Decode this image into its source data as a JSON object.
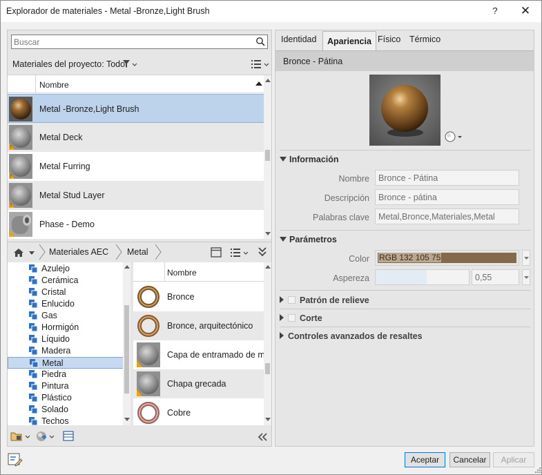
{
  "window": {
    "title": "Explorador de materiales - Metal -Bronze,Light Brush",
    "help": "?",
    "close": "✕"
  },
  "search": {
    "placeholder": "Buscar"
  },
  "project": {
    "label": "Materiales del proyecto: Todo"
  },
  "project_grid": {
    "header": "Nombre",
    "rows": [
      {
        "name": "Metal -Bronze,Light Brush",
        "thumb": "bronze",
        "selected": true
      },
      {
        "name": "Metal Deck",
        "thumb": "gray"
      },
      {
        "name": "Metal Furring",
        "thumb": "gray"
      },
      {
        "name": "Metal Stud Layer",
        "thumb": "gray"
      },
      {
        "name": "Phase - Demo",
        "thumb": "pipe"
      }
    ]
  },
  "library_bar": {
    "crumb1": "Materiales AEC",
    "crumb2": "Metal"
  },
  "tree": {
    "items": [
      "Azulejo",
      "Cerámica",
      "Cristal",
      "Enlucido",
      "Gas",
      "Hormigón",
      "Líquido",
      "Madera",
      "Metal",
      "Piedra",
      "Pintura",
      "Plástico",
      "Solado",
      "Techos"
    ],
    "selected_index": 8
  },
  "library_grid": {
    "header": "Nombre",
    "rows": [
      {
        "name": "Bronce",
        "thumb": "ring-bronze"
      },
      {
        "name": "Bronce, arquitectónico",
        "thumb": "ring-bronze"
      },
      {
        "name": "Capa de entramado de metal",
        "thumb": "gray"
      },
      {
        "name": "Chapa grecada",
        "thumb": "gray"
      },
      {
        "name": "Cobre",
        "thumb": "ring-copper"
      }
    ]
  },
  "tabs": {
    "items": [
      "Identidad",
      "Apariencia",
      "Físico",
      "Térmico"
    ],
    "active_index": 1
  },
  "asset": {
    "name": "Bronce - Pátina"
  },
  "info": {
    "title": "Información",
    "name_label": "Nombre",
    "name_value": "Bronce - Pátina",
    "desc_label": "Descripción",
    "desc_value": "Bronce - pátina",
    "kw_label": "Palabras clave",
    "kw_value": "Metal,Bronce,Materiales,Metal"
  },
  "params": {
    "title": "Parámetros",
    "color_label": "Color",
    "color_value": "RGB 132 105 75",
    "color_hex": "#84694b",
    "rough_label": "Aspereza",
    "rough_value": "0,55",
    "rough_fraction": 0.55
  },
  "sections": {
    "relief": "Patrón de relieve",
    "cut": "Corte",
    "highlights": "Controles avanzados de resaltes"
  },
  "buttons": {
    "ok": "Aceptar",
    "cancel": "Cancelar",
    "apply": "Aplicar"
  },
  "colors": {
    "selected_row": "#bdd3ec",
    "selected_tree": "#c6d9f1",
    "folder_blue": "#2e72c8",
    "warn": "#f0a400"
  }
}
